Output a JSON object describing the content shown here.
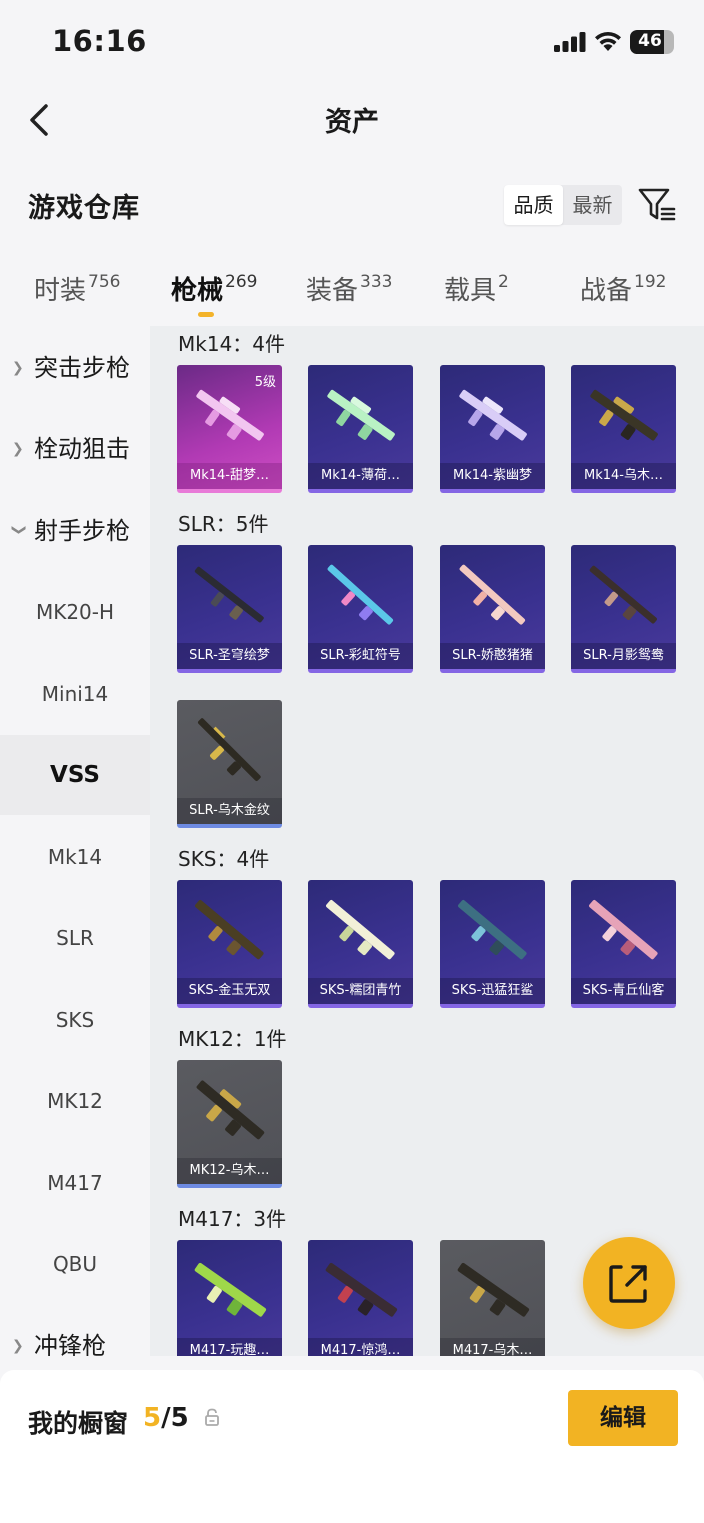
{
  "status_bar": {
    "time": "16:16",
    "battery": "46"
  },
  "header": {
    "title": "资产"
  },
  "section": {
    "title": "游戏仓库",
    "sort_options": [
      "品质",
      "最新"
    ]
  },
  "tabs": [
    {
      "label": "时装",
      "count": "756"
    },
    {
      "label": "枪械",
      "count": "269"
    },
    {
      "label": "装备",
      "count": "333"
    },
    {
      "label": "载具",
      "count": "2"
    },
    {
      "label": "战备",
      "count": "192"
    }
  ],
  "sidebar": {
    "items": [
      {
        "label": "突击步枪",
        "type": "group"
      },
      {
        "label": "栓动狙击",
        "type": "group"
      },
      {
        "label": "射手步枪",
        "type": "group"
      },
      {
        "label": "MK20-H",
        "type": "sub"
      },
      {
        "label": "Mini14",
        "type": "sub"
      },
      {
        "label": "VSS",
        "type": "sub"
      },
      {
        "label": "Mk14",
        "type": "sub"
      },
      {
        "label": "SLR",
        "type": "sub"
      },
      {
        "label": "SKS",
        "type": "sub"
      },
      {
        "label": "MK12",
        "type": "sub"
      },
      {
        "label": "M417",
        "type": "sub"
      },
      {
        "label": "QBU",
        "type": "sub"
      },
      {
        "label": "冲锋枪",
        "type": "group"
      }
    ]
  },
  "groups": [
    {
      "label": "Mk14：4件",
      "items": [
        {
          "name": "Mk14-甜梦…",
          "level": "5级",
          "style": "pink"
        },
        {
          "name": "Mk14-薄荷…",
          "style": "purple"
        },
        {
          "name": "Mk14-紫幽梦",
          "style": "purple"
        },
        {
          "name": "Mk14-乌木…",
          "style": "purple"
        }
      ]
    },
    {
      "label": "SLR：5件",
      "items": [
        {
          "name": "SLR-圣穹绘梦",
          "style": "purple"
        },
        {
          "name": "SLR-彩虹符号",
          "style": "purple"
        },
        {
          "name": "SLR-娇憨猪猪",
          "style": "purple"
        },
        {
          "name": "SLR-月影鸳鸯",
          "style": "purple"
        },
        {
          "name": "SLR-乌木金纹",
          "style": "gray"
        }
      ]
    },
    {
      "label": "SKS：4件",
      "items": [
        {
          "name": "SKS-金玉无双",
          "style": "purple"
        },
        {
          "name": "SKS-糯团青竹",
          "style": "purple"
        },
        {
          "name": "SKS-迅猛狂鲨",
          "style": "purple"
        },
        {
          "name": "SKS-青丘仙客",
          "style": "purple"
        }
      ]
    },
    {
      "label": "MK12：1件",
      "items": [
        {
          "name": "MK12-乌木…",
          "style": "gray"
        }
      ]
    },
    {
      "label": "M417：3件",
      "items": [
        {
          "name": "M417-玩趣…",
          "style": "purple"
        },
        {
          "name": "M417-惊鸿…",
          "style": "purple"
        },
        {
          "name": "M417-乌木…",
          "style": "gray"
        }
      ]
    }
  ],
  "bottom_bar": {
    "showcase_label": "我的橱窗",
    "current": "5",
    "total": "/5",
    "edit_label": "编辑"
  },
  "colors": {
    "accent": "#f2b323",
    "card_purple": "#3a3190",
    "card_pink": "#b13ab4",
    "card_gray": "#55565b"
  }
}
